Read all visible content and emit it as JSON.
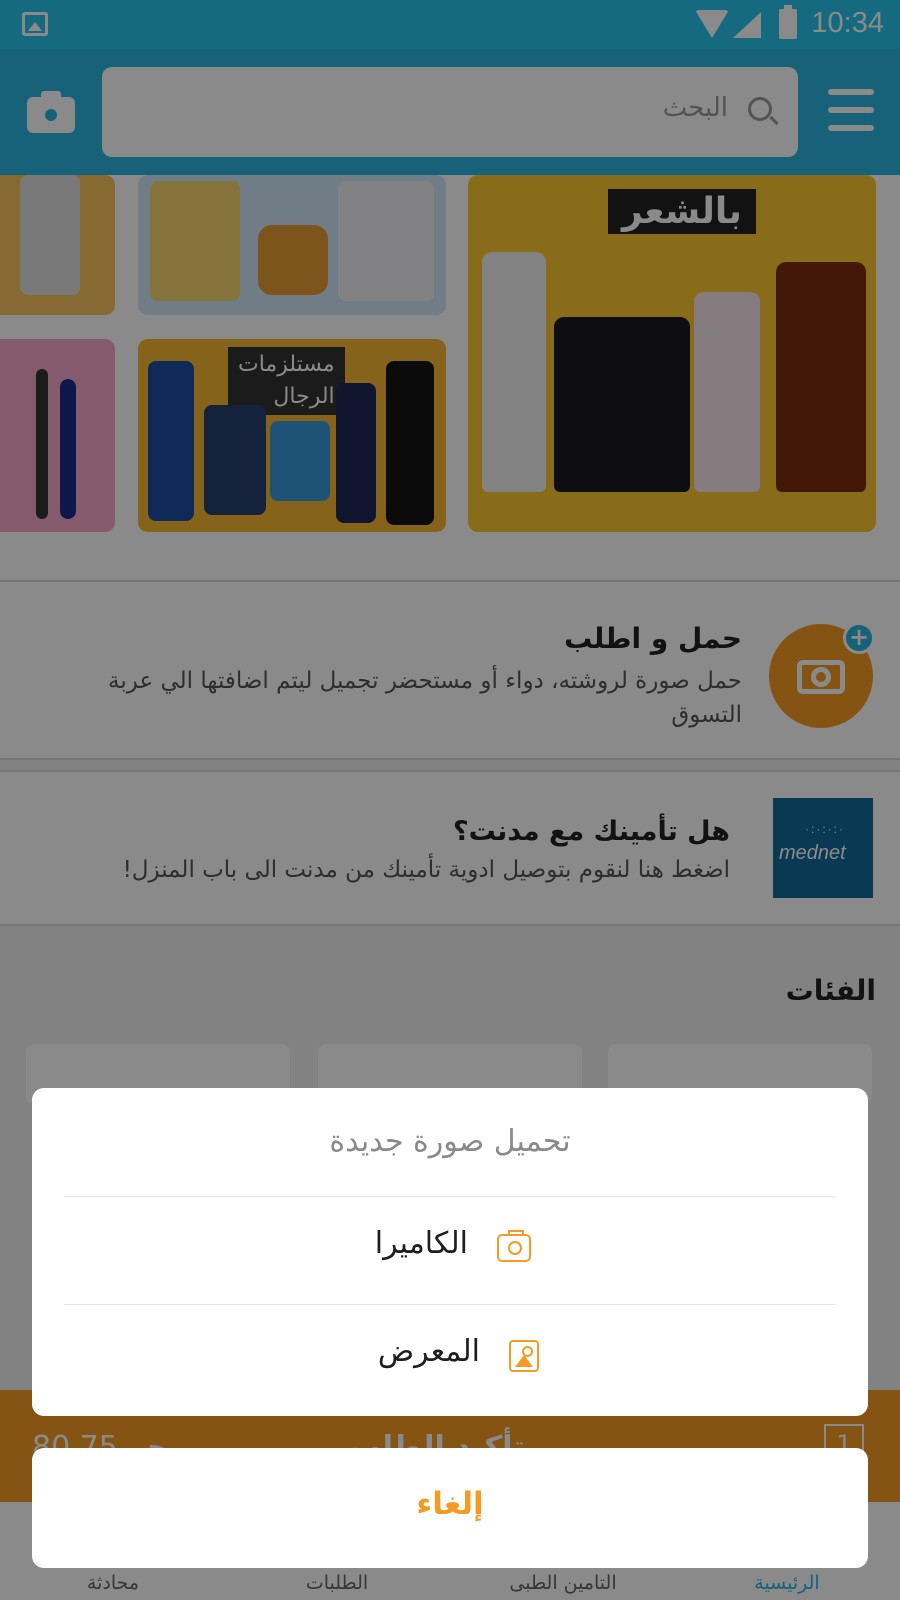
{
  "status_bar": {
    "time": "10:34"
  },
  "search": {
    "placeholder": "البحث"
  },
  "banners": {
    "hair_label": "بالشعر",
    "men_label_line1": "مستلزمات",
    "men_label_line2": "الرجال"
  },
  "upload_card": {
    "title": "حمل و اطلب",
    "description": "حمل صورة لروشته، دواء أو مستحضر تجميل ليتم اضافتها الي عربة التسوق"
  },
  "insurance_card": {
    "logo_text": "mednet",
    "title": "هل تأمينك مع مدنت؟",
    "description": "اضغط هنا لنقوم بتوصيل ادوية تأمينك من مدنت الى باب المنزل!"
  },
  "categories": {
    "title": "الفئات"
  },
  "checkout_bar": {
    "price": "80.75 جم",
    "label": "تأكيد الطلب",
    "count": "1"
  },
  "bottom_nav": {
    "items": [
      {
        "label": "محادثة"
      },
      {
        "label": "الطلبات"
      },
      {
        "label": "التامين الطبى"
      },
      {
        "label": "الرئيسية"
      }
    ],
    "active_index": 3
  },
  "dialog": {
    "title": "تحميل صورة جديدة",
    "camera_label": "الكاميرا",
    "gallery_label": "المعرض",
    "cancel_label": "إلغاء"
  },
  "colors": {
    "accent": "#f59b23",
    "primary": "#2bb6df"
  }
}
